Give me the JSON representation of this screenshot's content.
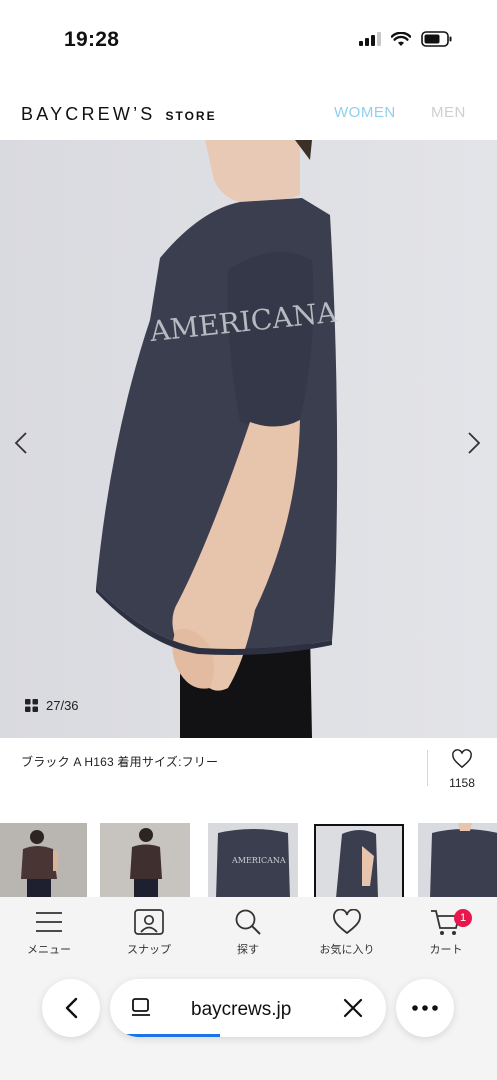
{
  "status_bar": {
    "time": "19:28",
    "icons": [
      "signal-icon",
      "wifi-icon",
      "battery-icon"
    ]
  },
  "header": {
    "logo_main": "BAYCREW’S",
    "logo_sub": "STORE",
    "nav": [
      {
        "label": "WOMEN",
        "color": "#8fd0ee"
      },
      {
        "label": "MEN",
        "color": "#cfcfcf"
      }
    ]
  },
  "gallery": {
    "counter": "27/36",
    "print_text": "AMERICANA",
    "prev_icon": "chevron-left-icon",
    "next_icon": "chevron-right-icon",
    "caption": "ブラック A H163 着用サイズ:フリー",
    "favorite_count": "1158",
    "thumbnails_count": 5,
    "selected_thumbnail": 4
  },
  "tabbar": {
    "items": [
      {
        "label": "メニュー",
        "icon": "menu-icon"
      },
      {
        "label": "スナップ",
        "icon": "snap-icon"
      },
      {
        "label": "探す",
        "icon": "search-icon"
      },
      {
        "label": "お気に入り",
        "icon": "heart-icon"
      },
      {
        "label": "カート",
        "icon": "cart-icon"
      }
    ],
    "cart_badge": "1",
    "badge_color": "#e8174c"
  },
  "browser": {
    "url": "baycrews.jp",
    "accent": "#1a73e8"
  }
}
